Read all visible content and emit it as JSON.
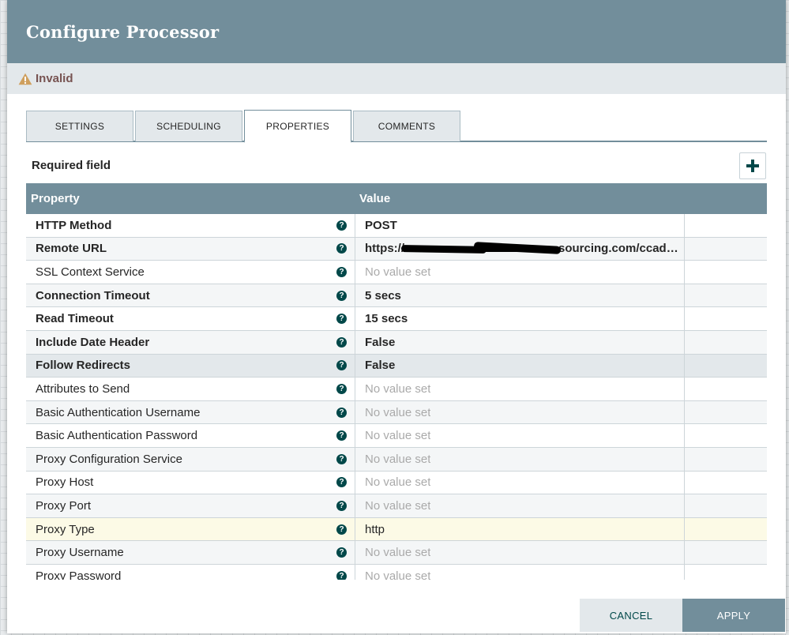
{
  "dialog": {
    "title": "Configure Processor",
    "status": "Invalid"
  },
  "tabs": [
    {
      "label": "SETTINGS",
      "active": false
    },
    {
      "label": "SCHEDULING",
      "active": false
    },
    {
      "label": "PROPERTIES",
      "active": true
    },
    {
      "label": "COMMENTS",
      "active": false
    }
  ],
  "properties_panel": {
    "required_label": "Required field",
    "add_button": "+",
    "columns": {
      "property": "Property",
      "value": "Value"
    },
    "help_glyph": "?",
    "rows": [
      {
        "name": "HTTP Method",
        "value": "POST"
      },
      {
        "name": "Remote URL",
        "value": "https://             sourcing.com/ccadmi..."
      },
      {
        "name": "SSL Context Service",
        "value": "No value set"
      },
      {
        "name": "Connection Timeout",
        "value": "5 secs"
      },
      {
        "name": "Read Timeout",
        "value": "15 secs"
      },
      {
        "name": "Include Date Header",
        "value": "False"
      },
      {
        "name": "Follow Redirects",
        "value": "False"
      },
      {
        "name": "Attributes to Send",
        "value": "No value set"
      },
      {
        "name": "Basic Authentication Username",
        "value": "No value set"
      },
      {
        "name": "Basic Authentication Password",
        "value": "No value set"
      },
      {
        "name": "Proxy Configuration Service",
        "value": "No value set"
      },
      {
        "name": "Proxy Host",
        "value": "No value set"
      },
      {
        "name": "Proxy Port",
        "value": "No value set"
      },
      {
        "name": "Proxy Type",
        "value": "http"
      },
      {
        "name": "Proxy Username",
        "value": "No value set"
      },
      {
        "name": "Proxy Password",
        "value": "No value set"
      }
    ]
  },
  "footer": {
    "cancel": "CANCEL",
    "apply": "APPLY"
  },
  "colors": {
    "header": "#728e9b",
    "status_text": "#775351",
    "warning": "#cf9f5d",
    "help_icon": "#004849",
    "highlight_row": "#fcfae6"
  },
  "icons": {
    "status": "warning-icon",
    "add": "plus-icon",
    "help": "help-icon"
  }
}
